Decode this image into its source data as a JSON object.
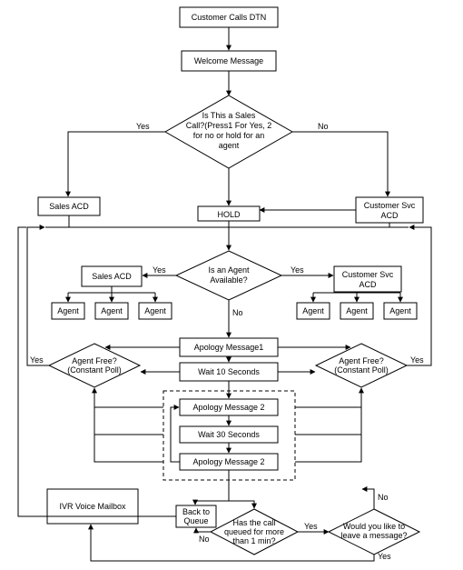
{
  "nodes": {
    "start": "Customer Calls DTN",
    "welcome": "Welcome Message",
    "salesQ": {
      "l1": "Is This a Sales",
      "l2": "Call?(Press1 For Yes, 2",
      "l3": "for no or hold for an",
      "l4": "agent"
    },
    "salesAcd1": "Sales ACD",
    "hold": "HOLD",
    "custAcd1": {
      "l1": "Customer Svc",
      "l2": "ACD"
    },
    "salesAcd2": "Sales ACD",
    "agentAvail": {
      "l1": "Is an Agent",
      "l2": "Available?"
    },
    "custAcd2": {
      "l1": "Customer Svc",
      "l2": "ACD"
    },
    "agent": "Agent",
    "apology1": "Apology Message1",
    "agentFreeL": {
      "l1": "Agent Free?",
      "l2": "(Constant Poll)"
    },
    "wait10": "Wait 10 Seconds",
    "agentFreeR": {
      "l1": "Agent Free?",
      "l2": "(Constant Poll)"
    },
    "apology2a": "Apology Message 2",
    "wait30": "Wait 30 Seconds",
    "apology2b": "Apology Message 2",
    "ivr": "IVR Voice Mailbox",
    "backq": {
      "l1": "Back to",
      "l2": "Queue"
    },
    "queued": {
      "l1": "Has the call",
      "l2": "queued for more",
      "l3": "than 1 min?"
    },
    "leave": {
      "l1": "Would you like to",
      "l2": "leave a message?"
    }
  },
  "labels": {
    "yes": "Yes",
    "no": "No"
  }
}
